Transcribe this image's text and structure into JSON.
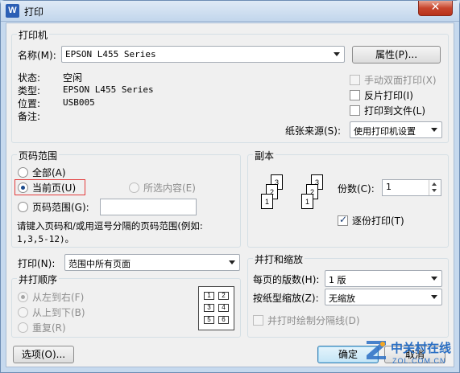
{
  "window": {
    "title": "打印",
    "app_icon": "wps-writer-icon",
    "icon_letter": "W",
    "close_label": "✕"
  },
  "printer": {
    "group_title": "打印机",
    "name_label": "名称(M):",
    "name_value": "EPSON L455 Series",
    "properties_button": "属性(P)...",
    "status_label": "状态:",
    "status_value": "空闲",
    "type_label": "类型:",
    "type_value": "EPSON L455 Series",
    "location_label": "位置:",
    "location_value": "USB005",
    "comment_label": "备注:",
    "manual_duplex": {
      "label": "手动双面打印(X)",
      "checked": false,
      "disabled": true
    },
    "reverse_print": {
      "label": "反片打印(I)",
      "checked": false
    },
    "print_to_file": {
      "label": "打印到文件(L)",
      "checked": false
    },
    "paper_source_label": "纸张来源(S):",
    "paper_source_value": "使用打印机设置"
  },
  "page_range": {
    "group_title": "页码范围",
    "all": {
      "label": "全部(A)",
      "selected": false
    },
    "current_page": {
      "label": "当前页(U)",
      "selected": true
    },
    "selection": {
      "label": "所选内容(E)",
      "selected": false,
      "disabled": true
    },
    "pages": {
      "label": "页码范围(G):",
      "selected": false,
      "value": ""
    },
    "hint_line1": "请键入页码和/或用逗号分隔的页码范围(例如:",
    "hint_line2": "1,3,5-12)。"
  },
  "copies": {
    "group_title": "副本",
    "count_label": "份数(C):",
    "count_value": "1",
    "collate": {
      "label": "逐份打印(T)",
      "checked": true
    },
    "stack_pages": [
      "1",
      "2",
      "3"
    ]
  },
  "print_what": {
    "label": "打印(N):",
    "value": "范围中所有页面"
  },
  "order": {
    "group_title": "并打顺序",
    "left_to_right": {
      "label": "从左到右(F)",
      "selected": true,
      "disabled": true
    },
    "top_to_bottom": {
      "label": "从上到下(B)",
      "selected": false,
      "disabled": true
    },
    "repeat": {
      "label": "重复(R)",
      "selected": false,
      "disabled": true
    },
    "preview_cells": [
      "1",
      "2",
      "3",
      "4",
      "5",
      "6"
    ]
  },
  "zoom": {
    "group_title": "并打和缩放",
    "pages_per_sheet_label": "每页的版数(H):",
    "pages_per_sheet_value": "1 版",
    "scale_label": "按纸型缩放(Z):",
    "scale_value": "无缩放",
    "draw_borders": {
      "label": "并打时绘制分隔线(D)",
      "checked": false,
      "disabled": true
    }
  },
  "footer": {
    "options_button": "选项(O)...",
    "ok_button": "确定",
    "cancel_button": "取消"
  },
  "watermark": {
    "brand_cn": "中关村在线",
    "brand_en": "ZOL.COM.CN"
  },
  "colors": {
    "titlebar": "#c6d9ee",
    "client_bg": "#f0f0f0",
    "close_red": "#c7452d",
    "highlight_red": "#e23c3c",
    "watermark_blue": "#2a6fc4"
  }
}
